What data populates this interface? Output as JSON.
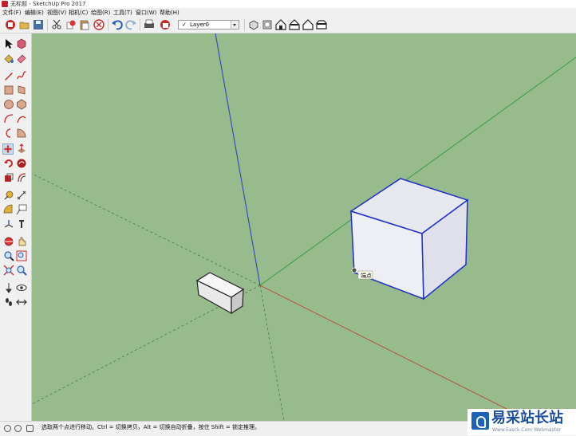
{
  "window": {
    "title": "无标题 - SketchUp Pro 2017"
  },
  "menu": [
    {
      "label": "文件(F)"
    },
    {
      "label": "编辑(E)"
    },
    {
      "label": "视图(V)"
    },
    {
      "label": "相机(C)"
    },
    {
      "label": "绘图(R)"
    },
    {
      "label": "工具(T)"
    },
    {
      "label": "窗口(W)"
    },
    {
      "label": "帮助(H)"
    }
  ],
  "toolbar": {
    "layer": {
      "check": "✓",
      "value": "Layer0"
    }
  },
  "viewport": {
    "background_color": "#98bb8d",
    "axes": {
      "blue": "#3346b8",
      "red": "#b04832",
      "green": "#2e9a35"
    },
    "inference_tooltip": "端点"
  },
  "status": {
    "hint": "选取两个点进行移动。Ctrl = 切换拷贝，Alt = 切换自动折叠，按住 Shift = 锁定推理。"
  },
  "watermark": {
    "brand": "易采站长站",
    "sub": "Www.Easck.Com Webmaster"
  }
}
